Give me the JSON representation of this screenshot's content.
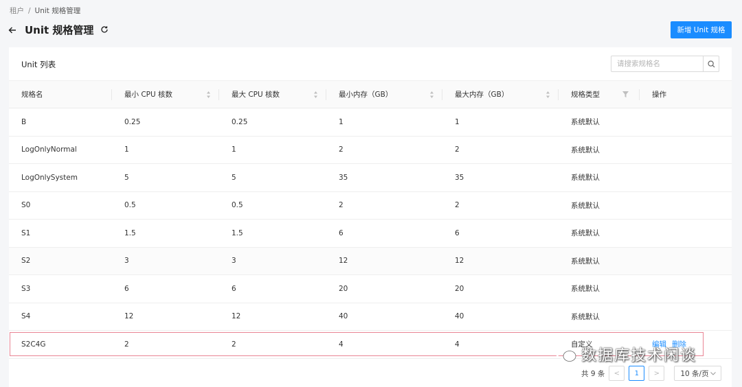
{
  "breadcrumb": {
    "parent": "租户",
    "separator": "/",
    "current": "Unit 规格管理"
  },
  "header": {
    "title": "Unit 规格管理",
    "new_button": "新增 Unit 规格"
  },
  "card": {
    "title": "Unit 列表",
    "search_placeholder": "请搜索规格名"
  },
  "table": {
    "columns": [
      "规格名",
      "最小 CPU 核数",
      "最大 CPU 核数",
      "最小内存（GB）",
      "最大内存（GB）",
      "规格类型",
      "操作"
    ],
    "rows": [
      [
        "B",
        "0.25",
        "0.25",
        "1",
        "1",
        "系统默认"
      ],
      [
        "LogOnlyNormal",
        "1",
        "1",
        "2",
        "2",
        "系统默认"
      ],
      [
        "LogOnlySystem",
        "5",
        "5",
        "35",
        "35",
        "系统默认"
      ],
      [
        "S0",
        "0.5",
        "0.5",
        "2",
        "2",
        "系统默认"
      ],
      [
        "S1",
        "1.5",
        "1.5",
        "6",
        "6",
        "系统默认"
      ],
      [
        "S2",
        "3",
        "3",
        "12",
        "12",
        "系统默认"
      ],
      [
        "S3",
        "6",
        "6",
        "20",
        "20",
        "系统默认"
      ],
      [
        "S4",
        "12",
        "12",
        "40",
        "40",
        "系统默认"
      ],
      [
        "S2C4G",
        "2",
        "2",
        "4",
        "4",
        "自定义"
      ]
    ],
    "actions": {
      "edit": "编辑",
      "delete": "删除"
    }
  },
  "pagination": {
    "total": "共 9 条",
    "prev": "<",
    "page": "1",
    "next": ">",
    "page_size": "10 条/页"
  },
  "watermark": {
    "text": "数据库技术闲谈"
  },
  "colors": {
    "primary": "#1a8cff",
    "highlight_border": "#e98393"
  }
}
